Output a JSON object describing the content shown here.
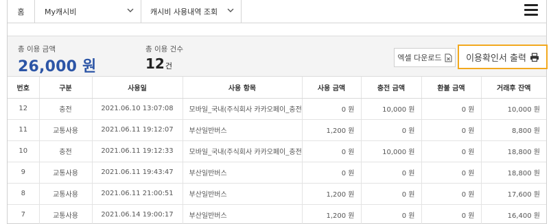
{
  "nav": {
    "home_label": "홈",
    "select1": "My캐시비",
    "select2": "캐시비 사용내역 조회"
  },
  "summary": {
    "total_amount_label": "총 이용 금액",
    "total_amount_value": "26,000 원",
    "total_count_label": "총 이용 건수",
    "total_count_value": "12",
    "total_count_unit": "건",
    "excel_button": "엑셀 다운로드",
    "print_button": "이용확인서 출력"
  },
  "table": {
    "headers": [
      "번호",
      "구분",
      "사용일",
      "사용 항목",
      "사용 금액",
      "충전 금액",
      "환불 금액",
      "거래후 잔액"
    ],
    "rows": [
      [
        "12",
        "충전",
        "2021.06.10 13:07:08",
        "모바일_국내(주식회사 카카오페이_충전)",
        "0 원",
        "10,000 원",
        "0 원",
        "10,000 원"
      ],
      [
        "11",
        "교통사용",
        "2021.06.11 19:12:07",
        "부산일반버스",
        "1,200 원",
        "0 원",
        "0 원",
        "8,800 원"
      ],
      [
        "10",
        "충전",
        "2021.06.11 19:12:33",
        "모바일_국내(주식회사 카카오페이_충전)",
        "0 원",
        "10,000 원",
        "0 원",
        "18,800 원"
      ],
      [
        "9",
        "교통사용",
        "2021.06.11 19:43:47",
        "부산일반버스",
        "0 원",
        "0 원",
        "0 원",
        "18,800 원"
      ],
      [
        "8",
        "교통사용",
        "2021.06.11 21:00:51",
        "부산일반버스",
        "1,200 원",
        "0 원",
        "0 원",
        "17,600 원"
      ],
      [
        "7",
        "교통사용",
        "2021.06.14 19:00:17",
        "부산일반버스",
        "1,200 원",
        "0 원",
        "0 원",
        "16,400 원"
      ]
    ]
  },
  "icons": {
    "excel": "excel-file-icon",
    "print": "printer-icon",
    "menu": "hamburger-menu-icon",
    "dropdown": "chevron-down-icon"
  },
  "colors": {
    "amount_blue": "#2c55a6",
    "highlight_orange": "#f2a81d"
  }
}
